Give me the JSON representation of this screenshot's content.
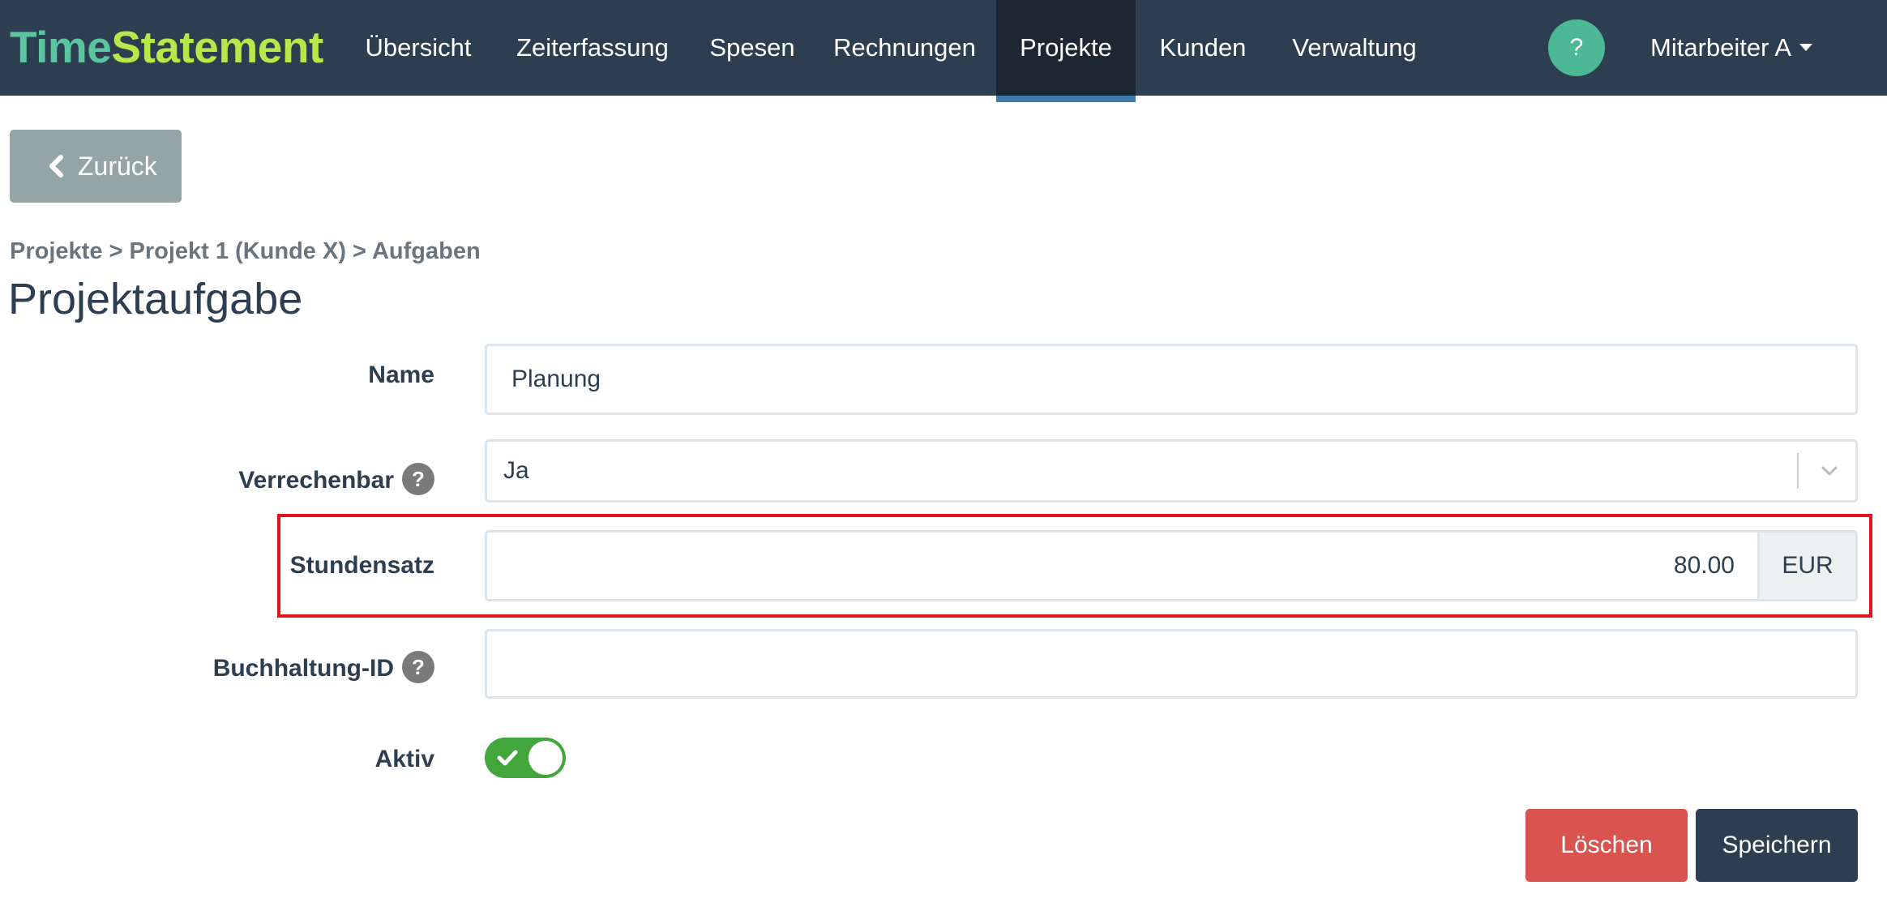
{
  "app": {
    "logo_part1": "Time",
    "logo_part2": "Statement"
  },
  "nav": {
    "items": [
      {
        "label": "Übersicht"
      },
      {
        "label": "Zeiterfassung"
      },
      {
        "label": "Spesen"
      },
      {
        "label": "Rechnungen"
      },
      {
        "label": "Projekte",
        "active": true
      },
      {
        "label": "Kunden"
      },
      {
        "label": "Verwaltung"
      }
    ],
    "help_label": "?",
    "user_label": "Mitarbeiter A"
  },
  "back_button": {
    "label": "Zurück",
    "icon": "chevron-left-icon"
  },
  "breadcrumb": "Projekte > Projekt 1 (Kunde X) > Aufgaben",
  "page_title": "Projektaufgabe",
  "form": {
    "name": {
      "label": "Name",
      "value": "Planung"
    },
    "billable": {
      "label": "Verrechenbar",
      "help": "?",
      "selected": "Ja"
    },
    "hourly_rate": {
      "label": "Stundensatz",
      "value": "80.00",
      "unit": "EUR"
    },
    "accounting_id": {
      "label": "Buchhaltung-ID",
      "help": "?",
      "value": ""
    },
    "active": {
      "label": "Aktiv",
      "checked": true
    }
  },
  "buttons": {
    "delete_label": "Löschen",
    "save_label": "Speichern"
  },
  "colors": {
    "navbar": "#2c3e50",
    "logo_time": "#5bc4a0",
    "logo_statement": "#b6e84a",
    "active_indicator": "#3b7bb0",
    "highlight": "#e2141b",
    "toggle_on": "#43a63d",
    "delete": "#d9534f",
    "save": "#2c3e50"
  }
}
